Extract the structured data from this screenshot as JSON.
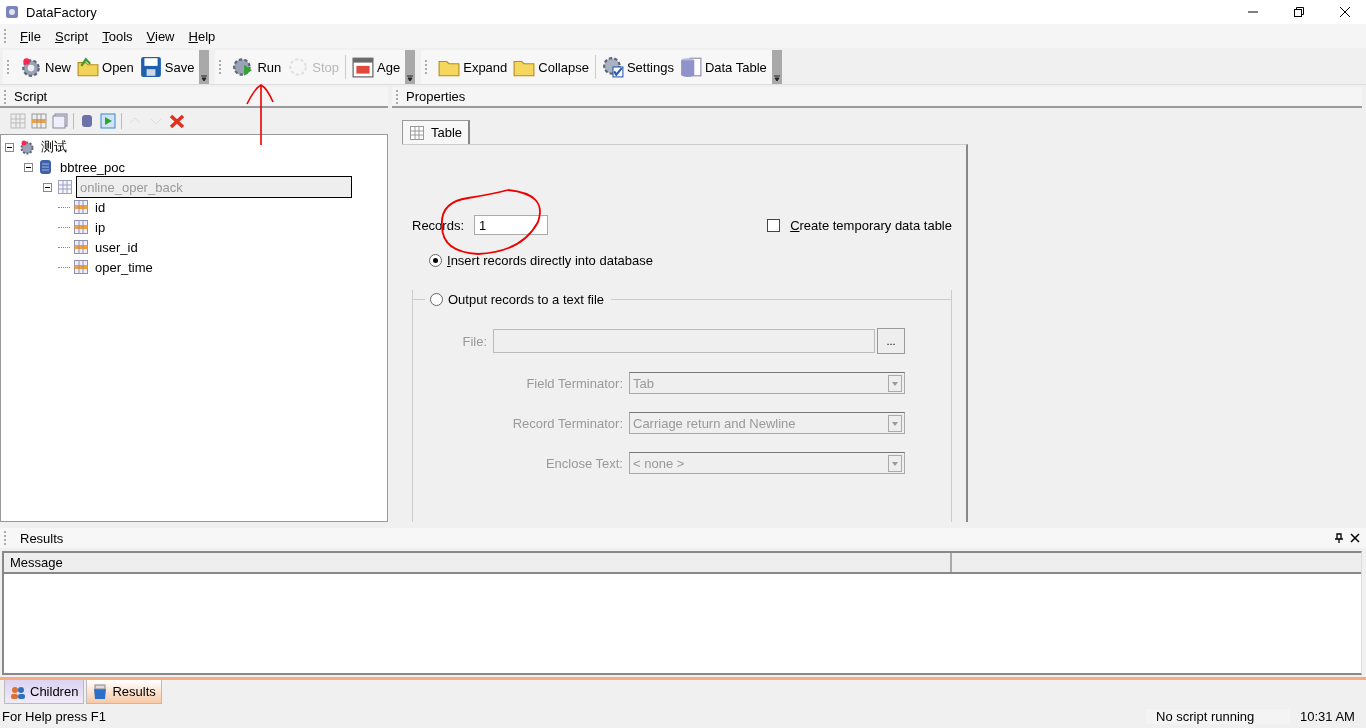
{
  "window": {
    "title": "DataFactory"
  },
  "menu": [
    "File",
    "Script",
    "Tools",
    "View",
    "Help"
  ],
  "toolbars": [
    {
      "items": [
        {
          "kind": "button",
          "label": "New",
          "disabled": false
        },
        {
          "kind": "button",
          "label": "Open",
          "disabled": false
        },
        {
          "kind": "button",
          "label": "Save",
          "disabled": false
        }
      ]
    },
    {
      "items": [
        {
          "kind": "button",
          "label": "Run",
          "disabled": false
        },
        {
          "kind": "button",
          "label": "Stop",
          "disabled": true
        },
        {
          "kind": "separator"
        },
        {
          "kind": "button",
          "label": "Age",
          "disabled": false
        }
      ]
    },
    {
      "items": [
        {
          "kind": "button",
          "label": "Expand",
          "disabled": false
        },
        {
          "kind": "button",
          "label": "Collapse",
          "disabled": false
        },
        {
          "kind": "separator"
        },
        {
          "kind": "button",
          "label": "Settings",
          "disabled": false
        },
        {
          "kind": "button",
          "label": "Data Table",
          "disabled": false
        }
      ]
    }
  ],
  "script_panel": {
    "title": "Script",
    "tree": [
      {
        "label": "测试",
        "kind": "script",
        "expanded": true,
        "selected": false,
        "children": [
          {
            "label": "bbtree_poc",
            "kind": "database",
            "expanded": true,
            "selected": false,
            "children": [
              {
                "label": "online_oper_back",
                "kind": "table",
                "expanded": true,
                "selected": true,
                "children": [
                  {
                    "label": "id",
                    "kind": "field",
                    "selected": false
                  },
                  {
                    "label": "ip",
                    "kind": "field",
                    "selected": false
                  },
                  {
                    "label": "user_id",
                    "kind": "field",
                    "selected": false
                  },
                  {
                    "label": "oper_time",
                    "kind": "field",
                    "selected": false
                  }
                ]
              }
            ]
          }
        ]
      }
    ]
  },
  "properties_panel": {
    "title": "Properties",
    "tabs": [
      {
        "label": "Table",
        "selected": true
      }
    ],
    "records": {
      "label": "Records:",
      "value": "1"
    },
    "temp_table": {
      "label": "Create temporary data table",
      "checked": false
    },
    "insert_option": {
      "label": "Insert records directly into database",
      "selected": true
    },
    "output_group": {
      "label": "Output records to a text file",
      "selected": false,
      "disabled": true,
      "file": {
        "label": "File:",
        "button": "..."
      },
      "selects": [
        {
          "label": "Field Terminator:",
          "value": "Tab"
        },
        {
          "label": "Record Terminator:",
          "value": "Carriage return and Newline"
        },
        {
          "label": "Enclose Text:",
          "value": "< none >"
        }
      ]
    }
  },
  "results_panel": {
    "title": "Results",
    "columns": [
      "Message"
    ]
  },
  "bottom_tabs": [
    {
      "label": "Children",
      "selected": false
    },
    {
      "label": "Results",
      "selected": true
    }
  ],
  "status_bar": {
    "help": "For Help press F1",
    "script_state": "No script running",
    "time": "10:31 AM"
  }
}
